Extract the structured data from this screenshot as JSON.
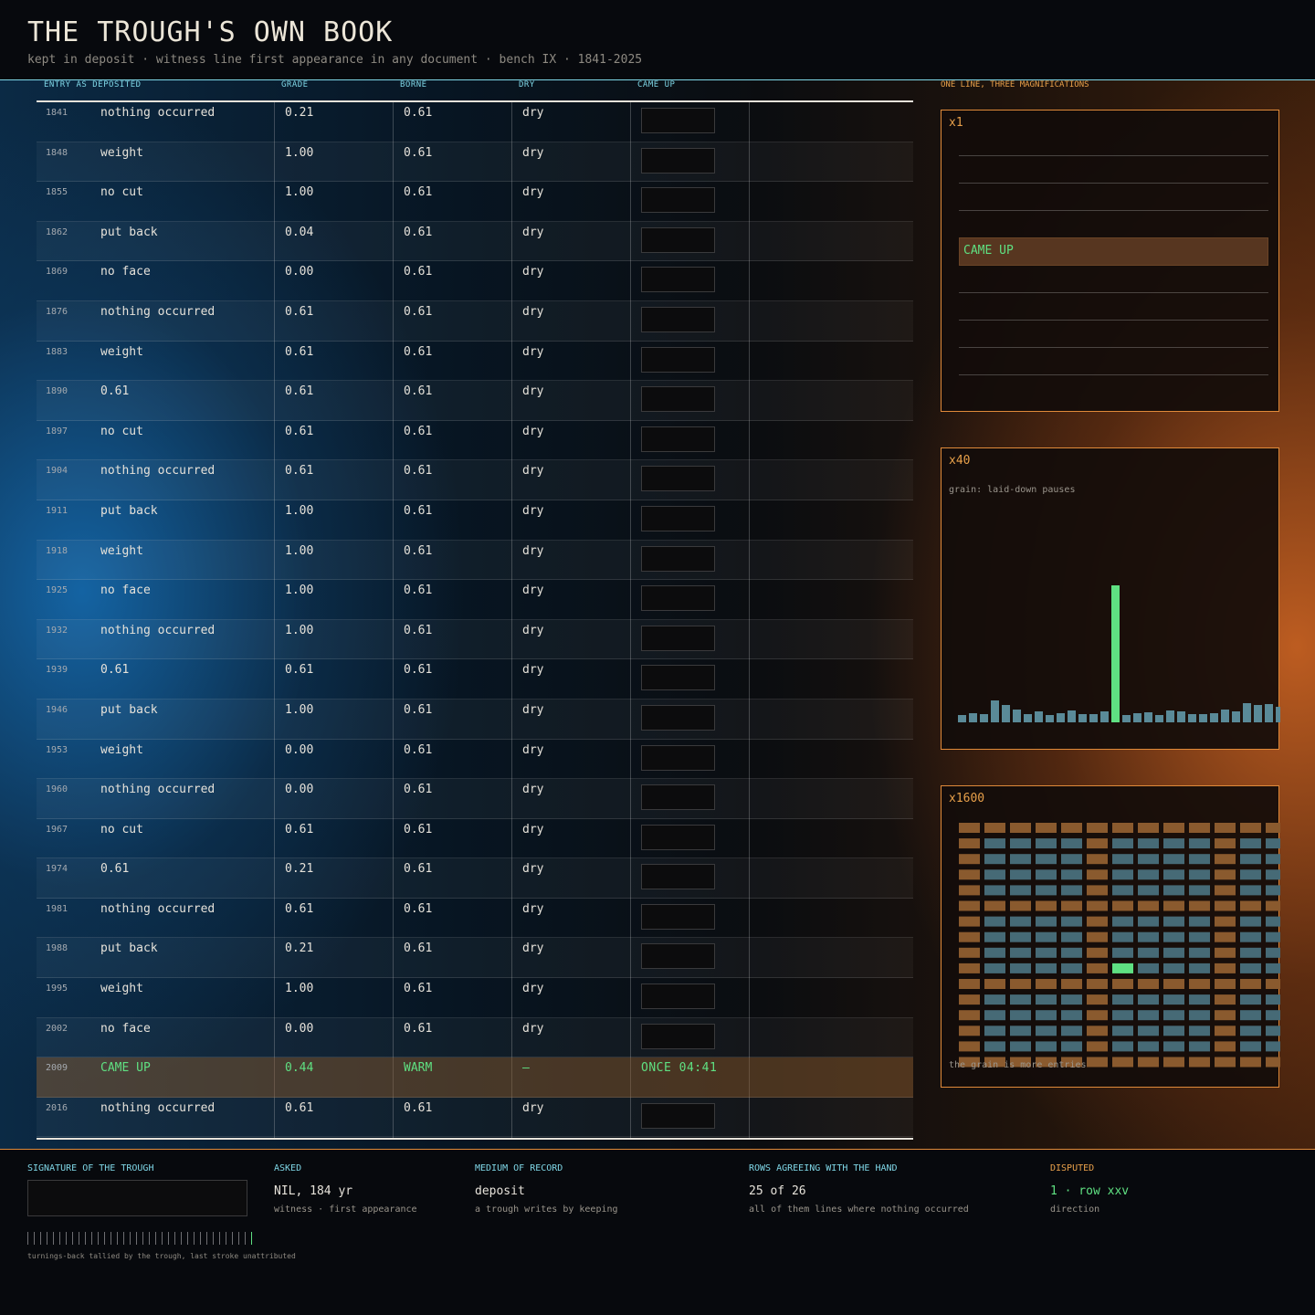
{
  "header": {
    "title": "THE TROUGH'S OWN BOOK",
    "subtitle": "kept in deposit  ·  witness line first appearance in any document  ·  bench IX  ·  1841-2025"
  },
  "table": {
    "columns": [
      "ENTRY AS DEPOSITED",
      "GRADE",
      "BORNE",
      "DRY",
      "CAME UP"
    ],
    "rows": [
      {
        "year": "1841",
        "entry": "nothing occurred",
        "grade": "0.21",
        "borne": "0.61",
        "dry": "dry"
      },
      {
        "year": "1848",
        "entry": "weight",
        "grade": "1.00",
        "borne": "0.61",
        "dry": "dry"
      },
      {
        "year": "1855",
        "entry": "no cut",
        "grade": "1.00",
        "borne": "0.61",
        "dry": "dry"
      },
      {
        "year": "1862",
        "entry": "put back",
        "grade": "0.04",
        "borne": "0.61",
        "dry": "dry"
      },
      {
        "year": "1869",
        "entry": "no face",
        "grade": "0.00",
        "borne": "0.61",
        "dry": "dry"
      },
      {
        "year": "1876",
        "entry": "nothing occurred",
        "grade": "0.61",
        "borne": "0.61",
        "dry": "dry"
      },
      {
        "year": "1883",
        "entry": "weight",
        "grade": "0.61",
        "borne": "0.61",
        "dry": "dry"
      },
      {
        "year": "1890",
        "entry": "0.61",
        "grade": "0.61",
        "borne": "0.61",
        "dry": "dry"
      },
      {
        "year": "1897",
        "entry": "no cut",
        "grade": "0.61",
        "borne": "0.61",
        "dry": "dry"
      },
      {
        "year": "1904",
        "entry": "nothing occurred",
        "grade": "0.61",
        "borne": "0.61",
        "dry": "dry"
      },
      {
        "year": "1911",
        "entry": "put back",
        "grade": "1.00",
        "borne": "0.61",
        "dry": "dry"
      },
      {
        "year": "1918",
        "entry": "weight",
        "grade": "1.00",
        "borne": "0.61",
        "dry": "dry"
      },
      {
        "year": "1925",
        "entry": "no face",
        "grade": "1.00",
        "borne": "0.61",
        "dry": "dry"
      },
      {
        "year": "1932",
        "entry": "nothing occurred",
        "grade": "1.00",
        "borne": "0.61",
        "dry": "dry"
      },
      {
        "year": "1939",
        "entry": "0.61",
        "grade": "0.61",
        "borne": "0.61",
        "dry": "dry"
      },
      {
        "year": "1946",
        "entry": "put back",
        "grade": "1.00",
        "borne": "0.61",
        "dry": "dry"
      },
      {
        "year": "1953",
        "entry": "weight",
        "grade": "0.00",
        "borne": "0.61",
        "dry": "dry"
      },
      {
        "year": "1960",
        "entry": "nothing occurred",
        "grade": "0.00",
        "borne": "0.61",
        "dry": "dry"
      },
      {
        "year": "1967",
        "entry": "no cut",
        "grade": "0.61",
        "borne": "0.61",
        "dry": "dry"
      },
      {
        "year": "1974",
        "entry": "0.61",
        "grade": "0.21",
        "borne": "0.61",
        "dry": "dry"
      },
      {
        "year": "1981",
        "entry": "nothing occurred",
        "grade": "0.61",
        "borne": "0.61",
        "dry": "dry"
      },
      {
        "year": "1988",
        "entry": "put back",
        "grade": "0.21",
        "borne": "0.61",
        "dry": "dry"
      },
      {
        "year": "1995",
        "entry": "weight",
        "grade": "1.00",
        "borne": "0.61",
        "dry": "dry"
      },
      {
        "year": "2002",
        "entry": "no face",
        "grade": "0.00",
        "borne": "0.61",
        "dry": "dry"
      },
      {
        "year": "2009",
        "entry": "CAME UP",
        "grade": "0.44",
        "borne": "WARM",
        "dry": "—",
        "came_up": "ONCE  04:41",
        "highlight": true
      },
      {
        "year": "2016",
        "entry": "nothing occurred",
        "grade": "0.61",
        "borne": "0.61",
        "dry": "dry"
      }
    ]
  },
  "magnifications": {
    "title": "ONE LINE, THREE MAGNIFICATIONS",
    "x1": {
      "label": "x1",
      "highlight_text": "CAME UP"
    },
    "x40": {
      "label": "x40",
      "note": "grain: laid-down pauses",
      "bar_values": [
        8,
        10,
        9,
        24,
        19,
        14,
        9,
        12,
        8,
        10,
        13,
        9,
        9,
        12,
        150,
        8,
        10,
        11,
        8,
        13,
        12,
        9,
        9,
        10,
        14,
        12,
        21,
        19,
        20,
        17
      ],
      "highlight_index": 14
    },
    "x1600": {
      "label": "x1600",
      "note": "the grain is more entries",
      "grid_cols": 13,
      "grid_rows": 16,
      "orange_cols": [
        0,
        5,
        10
      ],
      "orange_rows": [
        0,
        5,
        10,
        15
      ],
      "highlight_cell": [
        9,
        6
      ]
    }
  },
  "footer": {
    "signature": {
      "label": "SIGNATURE OF THE TROUGH",
      "tally_count": 36,
      "tally_note": "turnings-back tallied by the trough, last stroke unattributed"
    },
    "asked": {
      "label": "ASKED",
      "value": "NIL, 184 yr",
      "note": "witness  ·  first appearance"
    },
    "medium": {
      "label": "MEDIUM OF RECORD",
      "value": "deposit",
      "note": "a trough writes by keeping"
    },
    "agreeing": {
      "label": "ROWS AGREEING WITH THE HAND",
      "value": "25 of 26",
      "note": "all of them lines where nothing occurred"
    },
    "disputed": {
      "label": "DISPUTED",
      "value": "1 · row xxv",
      "note": "direction"
    }
  },
  "colors": {
    "accent_cyan": "#7fd6e6",
    "accent_orange": "#e08a3a",
    "highlight_green": "#5fe082"
  }
}
